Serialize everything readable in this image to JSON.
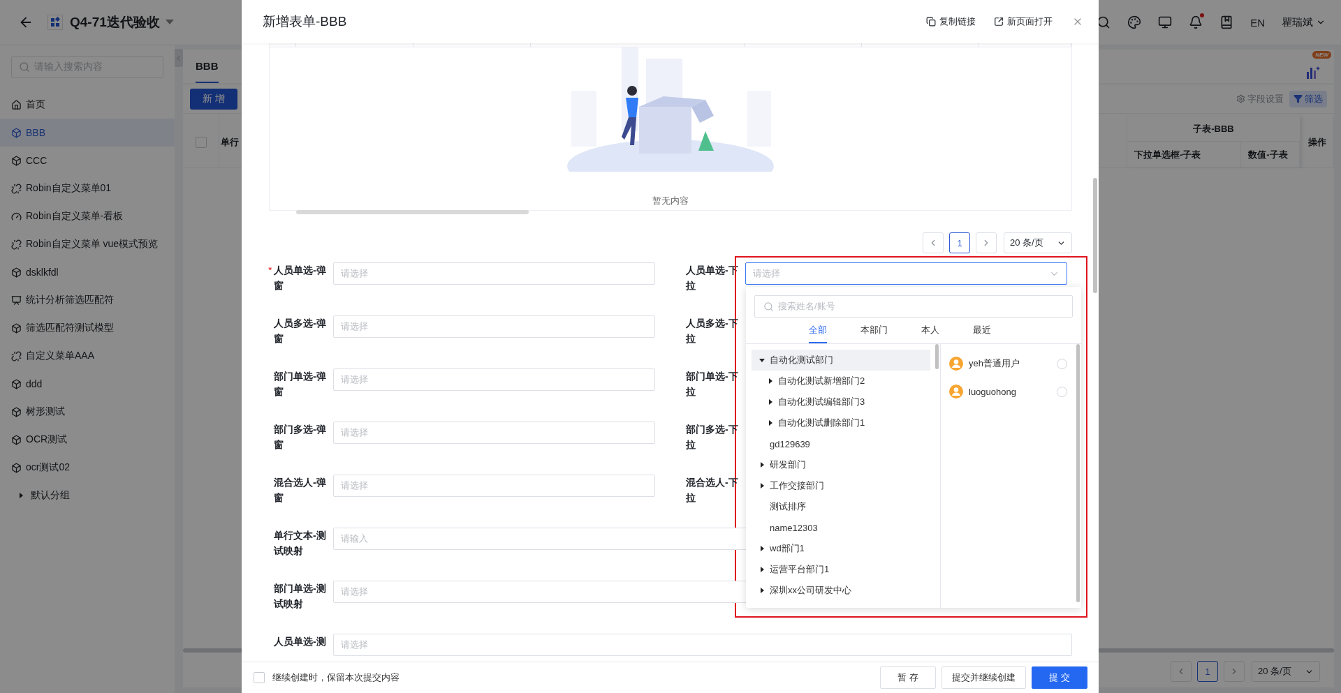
{
  "app_header": {
    "title": "Q4-71迭代验收",
    "has_notification": true,
    "language": "EN",
    "user": "瞿瑞斌"
  },
  "sidebar": {
    "search_placeholder": "请输入搜索内容",
    "items": [
      {
        "label": "首页",
        "kind": "home",
        "selected": false
      },
      {
        "label": "BBB",
        "kind": "cube",
        "selected": true
      },
      {
        "label": "CCC",
        "kind": "cube",
        "selected": false
      },
      {
        "label": "Robin自定义菜单01",
        "kind": "link",
        "selected": false
      },
      {
        "label": "Robin自定义菜单-看板",
        "kind": "dashboard",
        "selected": false
      },
      {
        "label": "Robin自定义菜单 vue模式预览",
        "kind": "link",
        "selected": false
      },
      {
        "label": "dsklkfdl",
        "kind": "cube",
        "selected": false
      },
      {
        "label": "统计分析筛选匹配符",
        "kind": "chart",
        "selected": false
      },
      {
        "label": "筛选匹配符测试模型",
        "kind": "cube",
        "selected": false
      },
      {
        "label": "自定义菜单AAA",
        "kind": "link",
        "selected": false
      },
      {
        "label": "ddd",
        "kind": "cube",
        "selected": false
      },
      {
        "label": "树形测试",
        "kind": "cube",
        "selected": false
      },
      {
        "label": "OCR测试",
        "kind": "cube",
        "selected": false
      },
      {
        "label": "ocr测试02",
        "kind": "cube",
        "selected": false
      }
    ],
    "groups": [
      {
        "label": "默认分组",
        "expanded": false
      }
    ]
  },
  "page": {
    "tabs": [
      {
        "label": "BBB",
        "selected": true
      }
    ],
    "add_button": "新 增",
    "new_badge": "NEW",
    "field_settings": "字段设置",
    "filter_button": "筛选",
    "table": {
      "select_all": {
        "checked": false
      },
      "first_column": "单行",
      "group_header": "子表-BBB",
      "sub_columns": [
        "下拉单选框-子表",
        "数值-子表"
      ],
      "action_column": "操作"
    },
    "pagination": {
      "pages": [
        {
          "label": "1",
          "selected": true
        }
      ],
      "page_size": "20 条/页"
    }
  },
  "modal": {
    "title": "新增表单-BBB",
    "actions": [
      {
        "label": "复制链接",
        "kind": "copy"
      },
      {
        "label": "新页面打开",
        "kind": "open"
      }
    ],
    "subtable": {
      "empty_text": "暂无内容",
      "pagination": {
        "pages": [
          {
            "label": "1",
            "selected": true
          }
        ],
        "page_size": "20 条/页"
      }
    },
    "required_mark": "*",
    "form_rows": [
      {
        "kind": "pair",
        "fields": [
          {
            "label": "人员单选-弹窗",
            "required": true,
            "placeholder": "请选择"
          },
          {
            "label": "人员单选-下拉",
            "required": false,
            "placeholder": "请选择",
            "open": true
          }
        ]
      },
      {
        "kind": "pair",
        "fields": [
          {
            "label": "人员多选-弹窗",
            "required": false,
            "placeholder": "请选择"
          },
          {
            "label": "人员多选-下拉",
            "required": false
          }
        ]
      },
      {
        "kind": "pair",
        "fields": [
          {
            "label": "部门单选-弹窗",
            "required": false,
            "placeholder": "请选择"
          },
          {
            "label": "部门单选-下拉",
            "required": false
          }
        ]
      },
      {
        "kind": "pair",
        "fields": [
          {
            "label": "部门多选-弹窗",
            "required": false,
            "placeholder": "请选择"
          },
          {
            "label": "部门多选-下拉",
            "required": false
          }
        ]
      },
      {
        "kind": "pair",
        "fields": [
          {
            "label": "混合选人-弹窗",
            "required": false,
            "placeholder": "请选择"
          },
          {
            "label": "混合选人-下拉",
            "required": false
          }
        ]
      },
      {
        "kind": "full",
        "fields": [
          {
            "label": "单行文本-测试映射",
            "required": false,
            "placeholder": "请输入"
          }
        ]
      },
      {
        "kind": "full",
        "fields": [
          {
            "label": "部门单选-测试映射",
            "required": false,
            "placeholder": "请选择"
          }
        ]
      },
      {
        "kind": "full",
        "fields": [
          {
            "label": "人员单选-测",
            "required": false,
            "placeholder": "请选择"
          }
        ]
      }
    ],
    "dropdown": {
      "search_placeholder": "搜索姓名/账号",
      "highlight_frame": true,
      "tabs": [
        {
          "label": "全部",
          "selected": true
        },
        {
          "label": "本部门",
          "selected": false
        },
        {
          "label": "本人",
          "selected": false
        },
        {
          "label": "最近",
          "selected": false
        }
      ],
      "tree": [
        {
          "label": "自动化测试部门",
          "kind": "folder",
          "expanded": true,
          "active": true,
          "children": [
            {
              "label": "自动化测试新增部门2",
              "kind": "folder",
              "expanded": false,
              "active": false
            },
            {
              "label": "自动化测试编辑部门3",
              "kind": "folder",
              "expanded": false,
              "active": false
            },
            {
              "label": "自动化测试删除部门1",
              "kind": "folder",
              "expanded": false,
              "active": false
            }
          ]
        },
        {
          "label": "gd129639",
          "kind": "leaf",
          "active": false
        },
        {
          "label": "研发部门",
          "kind": "folder",
          "expanded": false,
          "active": false
        },
        {
          "label": "工作交接部门",
          "kind": "folder",
          "expanded": false,
          "active": false
        },
        {
          "label": "测试排序",
          "kind": "leaf",
          "active": false
        },
        {
          "label": "name12303",
          "kind": "leaf",
          "active": false
        },
        {
          "label": "wd部门1",
          "kind": "folder",
          "expanded": false,
          "active": false
        },
        {
          "label": "运营平台部门1",
          "kind": "folder",
          "expanded": false,
          "active": false
        },
        {
          "label": "深圳xx公司研发中心",
          "kind": "folder",
          "expanded": false,
          "active": false
        }
      ],
      "users": [
        {
          "name": "yeh普通用户",
          "selected": false
        },
        {
          "name": "luoguohong",
          "selected": false
        }
      ]
    },
    "footer": {
      "keep_content": {
        "label": "继续创建时，保留本次提交内容",
        "checked": false
      },
      "buttons": [
        {
          "label": "暂 存",
          "kind": "default"
        },
        {
          "label": "提交并继续创建",
          "kind": "default"
        },
        {
          "label": "提 交",
          "kind": "primary"
        }
      ]
    }
  }
}
